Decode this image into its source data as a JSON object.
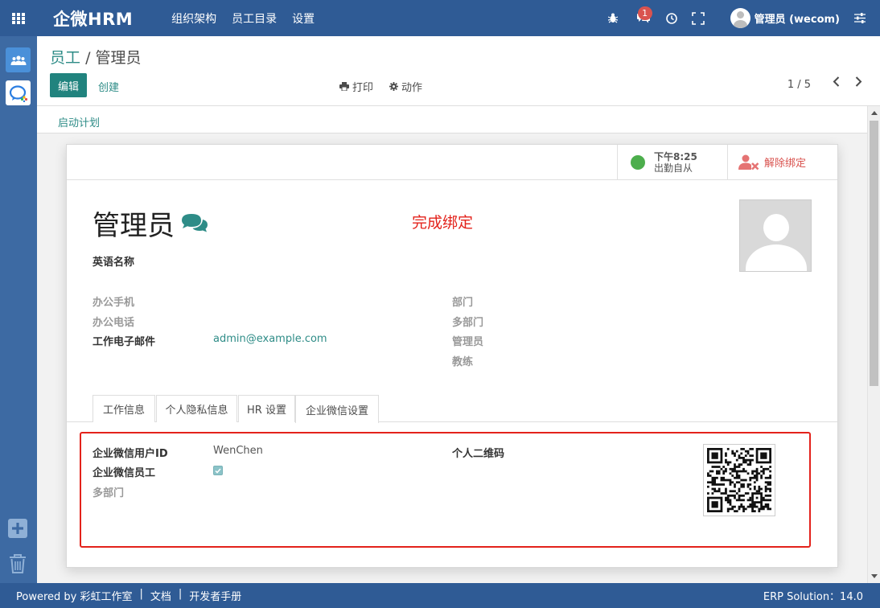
{
  "navbar": {
    "brand": "企微HRM",
    "menu": [
      "组织架构",
      "员工目录",
      "设置"
    ],
    "message_count": "1",
    "user_name": "管理员 (wecom)"
  },
  "breadcrumb": {
    "parent": "员工",
    "separator": "/",
    "current": "管理员"
  },
  "control_panel": {
    "edit_label": "编辑",
    "create_label": "创建",
    "print_label": "打印",
    "action_label": "动作",
    "pager": "1 / 5"
  },
  "statusbar": {
    "launch_plan": "启动计划"
  },
  "button_box": {
    "presence_time": "下午8:25",
    "presence_label": "出勤自从",
    "unbind_label": "解除绑定"
  },
  "employee": {
    "name": "管理员",
    "bind_status": "完成绑定",
    "english_name_label": "英语名称",
    "mobile_label": "办公手机",
    "phone_label": "办公电话",
    "email_label": "工作电子邮件",
    "email_value": "admin@example.com",
    "department_label": "部门",
    "multi_department_label": "多部门",
    "manager_label": "管理员",
    "coach_label": "教练"
  },
  "tabs": [
    "工作信息",
    "个人隐私信息",
    "HR 设置",
    "企业微信设置"
  ],
  "wecom": {
    "userid_label": "企业微信用户ID",
    "userid_value": "WenChen",
    "is_wecom_label": "企业微信员工",
    "is_wecom_checked": true,
    "multi_department_label": "多部门",
    "qrcode_label": "个人二维码"
  },
  "footer": {
    "powered_by": "Powered by 彩虹工作室",
    "docs": "文档",
    "dev_manual": "开发者手册",
    "separator": "|",
    "version": "ERP Solution：14.0"
  },
  "colors": {
    "navbar": "#2f5b95",
    "sidebar": "#3d6aa3",
    "primary": "#21837e",
    "link": "#2e8c87",
    "alert": "#e3221b"
  }
}
